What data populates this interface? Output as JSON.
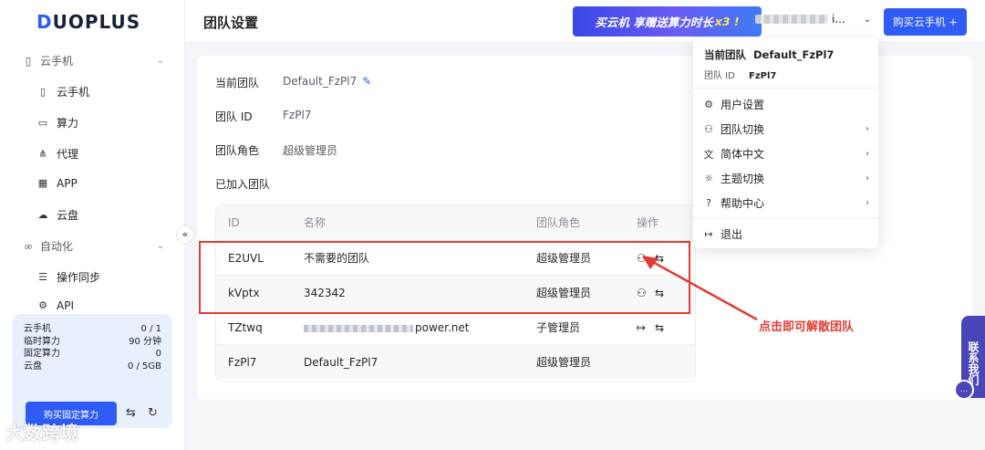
{
  "brand": {
    "logo": "DUOPLUS"
  },
  "sidebar": {
    "groups": [
      {
        "label": "云手机",
        "icon": "phone-group-icon"
      },
      {
        "label": "自动化",
        "icon": "automation-icon"
      }
    ],
    "items": [
      {
        "label": "云手机",
        "icon": "phone-icon"
      },
      {
        "label": "算力",
        "icon": "monitor-icon"
      },
      {
        "label": "代理",
        "icon": "proxy-icon"
      },
      {
        "label": "APP",
        "icon": "grid-icon"
      },
      {
        "label": "云盘",
        "icon": "cloud-icon"
      },
      {
        "label": "操作同步",
        "icon": "sync-icon"
      },
      {
        "label": "API",
        "icon": "api-icon"
      }
    ],
    "quota": [
      {
        "label": "云手机",
        "value": "0 / 1"
      },
      {
        "label": "临时算力",
        "value": "90 分钟"
      },
      {
        "label": "固定算力",
        "value": "0"
      },
      {
        "label": "云盘",
        "value": "0 / 5GB"
      }
    ],
    "buy_fixed_label": "购买固定算力",
    "watermark": "大数跨境"
  },
  "header": {
    "title": "团队设置",
    "promo_text": "买云机 享赠送算力时长",
    "promo_highlight": "x3 !",
    "user_suffix": "i...",
    "buy_label": "购买云手机 +"
  },
  "team": {
    "current_label": "当前团队",
    "current_value": "Default_FzPl7",
    "id_label": "团队 ID",
    "id_value": "FzPl7",
    "role_label": "团队角色",
    "role_value": "超级管理员",
    "joined_label": "已加入团队"
  },
  "table": {
    "headers": {
      "id": "ID",
      "name": "名称",
      "role": "团队角色",
      "action": "操作"
    },
    "rows": [
      {
        "id": "E2UVL",
        "name": "不需要的团队",
        "role": "超级管理员"
      },
      {
        "id": "kVptx",
        "name": "342342",
        "role": "超级管理员"
      },
      {
        "id": "TZtwq",
        "name": "power.net",
        "role": "子管理员"
      },
      {
        "id": "FzPl7",
        "name": "Default_FzPl7",
        "role": "超级管理员"
      }
    ]
  },
  "dropdown": {
    "current_team_label": "当前团队",
    "current_team_value": "Default_FzPl7",
    "team_id_label": "团队 ID",
    "team_id_value": "FzPl7",
    "items": [
      {
        "label": "用户设置",
        "icon": "gear-icon"
      },
      {
        "label": "团队切换",
        "icon": "team-icon"
      },
      {
        "label": "简体中文",
        "icon": "translate-icon"
      },
      {
        "label": "主题切换",
        "icon": "sun-icon"
      },
      {
        "label": "帮助中心",
        "icon": "help-icon"
      },
      {
        "label": "退出",
        "icon": "logout-icon"
      }
    ]
  },
  "annotation": {
    "text": "点击即可解散团队",
    "color": "#e23b32"
  },
  "contact_tab": "联系我们",
  "colors": {
    "accent": "#2f5cf6",
    "annotation": "#e23b32",
    "contact": "#4a45b8"
  }
}
